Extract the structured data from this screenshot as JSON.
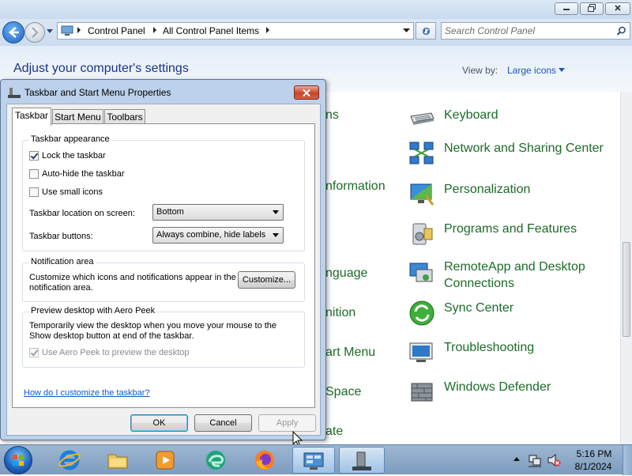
{
  "window": {
    "address": {
      "crumbs": [
        "Control Panel",
        "All Control Panel Items"
      ],
      "search_placeholder": "Search Control Panel"
    },
    "heading": "Adjust your computer's settings",
    "view_by_label": "View by:",
    "view_by_value": "Large icons"
  },
  "cp_items": [
    {
      "label": "Keyboard",
      "icon": "keyboard-icon"
    },
    {
      "label": "Network and Sharing Center",
      "icon": "network-icon"
    },
    {
      "label": "Personalization",
      "icon": "personalization-icon"
    },
    {
      "label": "Programs and Features",
      "icon": "programs-icon"
    },
    {
      "label": "RemoteApp and Desktop Connections",
      "icon": "remoteapp-icon"
    },
    {
      "label": "Sync Center",
      "icon": "sync-icon"
    },
    {
      "label": "Troubleshooting",
      "icon": "troubleshooting-icon"
    },
    {
      "label": "Windows Defender",
      "icon": "defender-icon"
    }
  ],
  "cp_left_fragments": [
    "ns",
    "nformation",
    "nguage",
    "nition",
    "art Menu",
    "Space",
    "ate"
  ],
  "dialog": {
    "title": "Taskbar and Start Menu Properties",
    "tabs": [
      "Taskbar",
      "Start Menu",
      "Toolbars"
    ],
    "appearance": {
      "title": "Taskbar appearance",
      "lock": {
        "label": "Lock the taskbar",
        "checked": true
      },
      "autohide": {
        "label": "Auto-hide the taskbar",
        "checked": false
      },
      "small_icons": {
        "label": "Use small icons",
        "checked": false
      },
      "location_label": "Taskbar location on screen:",
      "location_value": "Bottom",
      "buttons_label": "Taskbar buttons:",
      "buttons_value": "Always combine, hide labels"
    },
    "notification": {
      "title": "Notification area",
      "text_line1": "Customize which icons and notifications appear in the",
      "text_line2": "notification area.",
      "button": "Customize..."
    },
    "aero": {
      "title": "Preview desktop with Aero Peek",
      "text_line1": "Temporarily view the desktop when you move your mouse to the",
      "text_line2": "Show desktop button at end of the taskbar.",
      "checkbox": {
        "label": "Use Aero Peek to preview the desktop",
        "checked": true,
        "disabled": true
      }
    },
    "help_link": "How do I customize the taskbar?",
    "ok": "OK",
    "cancel": "Cancel",
    "apply": "Apply"
  },
  "taskbar": {
    "pinned": [
      "internet-explorer-icon",
      "folder-icon",
      "media-player-icon",
      "edge-icon",
      "firefox-icon",
      "control-panel-icon",
      "properties-window-icon"
    ],
    "time": "5:16 PM",
    "date": "8/1/2024"
  }
}
